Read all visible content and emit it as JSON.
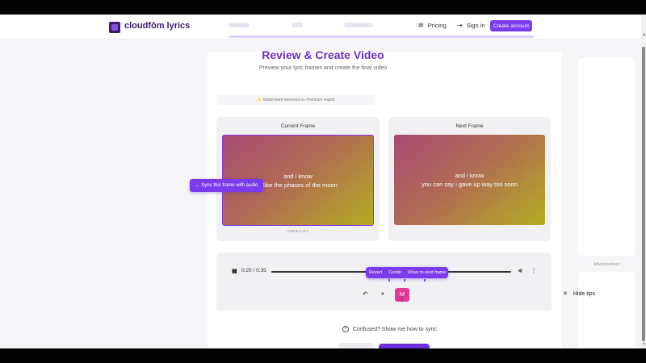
{
  "header": {
    "brand": "cloudfōm lyrics",
    "nav_pricing": "Pricing",
    "nav_signin": "Sign in",
    "create_account": "Create account"
  },
  "page": {
    "title": "Review & Create Video",
    "subtitle": "Preview your lyric frames and create the final video",
    "watermark_note": "✨ Watermark removed on Premium export"
  },
  "frames": {
    "current": {
      "label": "Current Frame",
      "line1": "and i know",
      "line2": "s like the phases of the moon",
      "count": "Frame 5 of 6"
    },
    "next": {
      "label": "Next Frame",
      "line1": "and i know",
      "line2": "you can say i gave up way too soon"
    },
    "sync_tip": "← Sync this frame with audio"
  },
  "player": {
    "time": "0:20 / 0:35",
    "progress": 0.571,
    "tips": [
      "Revert",
      "Contin",
      "Move to next frame"
    ],
    "mark_label": "M"
  },
  "help": {
    "confused": "Confused? Show me how to sync"
  },
  "sidebar": {
    "ad_label": "Advertisement",
    "hide_tips": "Hide tips"
  },
  "colors": {
    "accent": "#7c3aed",
    "title": "#6b2fc2",
    "mark": "#e33b93"
  },
  "icons": {
    "pricing": "sparkle-icon",
    "signin": "login-icon",
    "play": "pause-icon",
    "volume": "volume-icon",
    "more": "more-vertical-icon",
    "undo": "undo-icon",
    "help": "help-circle-icon",
    "close": "close-icon"
  }
}
